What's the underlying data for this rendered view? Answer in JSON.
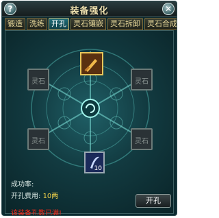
{
  "window": {
    "title": "装备强化"
  },
  "tabs": [
    {
      "label": "锻造"
    },
    {
      "label": "洗练"
    },
    {
      "label": "开孔"
    },
    {
      "label": "灵石镶嵌"
    },
    {
      "label": "灵石拆卸"
    },
    {
      "label": "灵石合成"
    }
  ],
  "active_tab": "开孔",
  "slots": {
    "socket_label": "灵石",
    "gem_count": "10"
  },
  "info": {
    "success_rate_label": "成功率:",
    "cost_label": "开孔费用:",
    "cost_value": "10两",
    "warning": "该装备孔数已满!"
  },
  "actions": {
    "open_socket_label": "开孔"
  },
  "colors": {
    "accent": "#f2d24a",
    "warning": "#ff2a1a"
  },
  "icons": {
    "help": "help-icon",
    "close": "close-icon"
  }
}
